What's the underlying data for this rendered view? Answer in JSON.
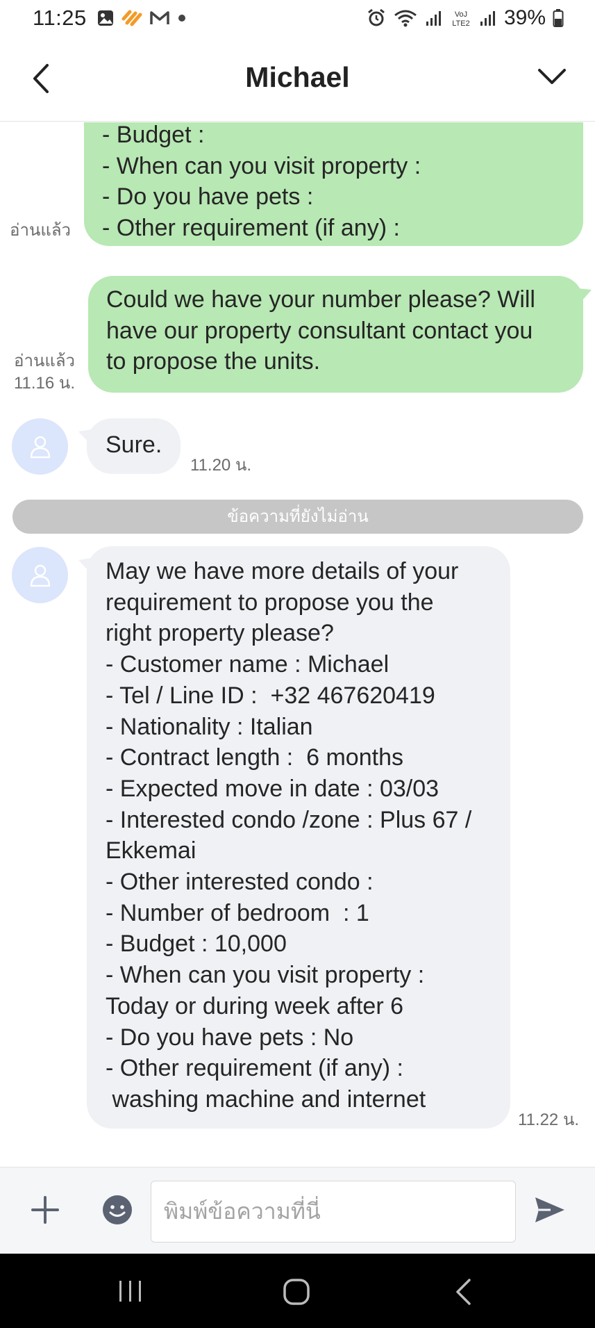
{
  "status_bar": {
    "time": "11:25",
    "battery": "39%",
    "network": "LTE2",
    "left_icons": [
      "gallery-icon",
      "shopee-icon",
      "gmail-icon",
      "dot-icon"
    ],
    "right_icons": [
      "alarm-icon",
      "wifi-icon",
      "signal-icon",
      "volte-icon",
      "signal-icon",
      "battery-icon"
    ]
  },
  "header": {
    "title": "Michael",
    "back_icon": "chevron-left-icon",
    "menu_icon": "chevron-down-icon"
  },
  "messages": {
    "m1": {
      "lines": [
        "- Budget :",
        "- When can you visit property :",
        "- Do you have pets :",
        "- Other requirement (if any) :"
      ],
      "status": "อ่านแล้ว"
    },
    "m2": {
      "lines": [
        "Could we have your number please? Will",
        "have our property consultant contact you",
        "to propose the units."
      ],
      "status": "อ่านแล้ว",
      "time": "11.16 น."
    },
    "m3": {
      "text": "Sure.",
      "time": "11.20 น."
    },
    "unread_divider": "ข้อความที่ยังไม่อ่าน",
    "m4": {
      "lines": [
        "May we have more details of your",
        "requirement to propose you the",
        "right property please?",
        "- Customer name : Michael",
        "- Tel / Line ID :  +32 467620419",
        "- Nationality : Italian",
        "- Contract length :  6 months",
        "- Expected move in date : 03/03",
        "- Interested condo /zone : Plus 67 /",
        "Ekkemai",
        "- Other interested condo :",
        "- Number of bedroom  : 1",
        "- Budget : 10,000",
        "- When can you visit property :",
        "Today or during week after 6",
        "- Do you have pets : No",
        "- Other requirement (if any) :",
        " washing machine and internet"
      ],
      "time": "11.22 น."
    }
  },
  "input_bar": {
    "placeholder": "พิมพ์ข้อความที่นี่",
    "value": ""
  },
  "colors": {
    "outgoing_bubble": "#b8e8b4",
    "incoming_bubble": "#eff1f4",
    "avatar_bg": "#dbe5fb",
    "divider_bg": "#c6c6c6",
    "icon_gray": "#5b6272"
  }
}
